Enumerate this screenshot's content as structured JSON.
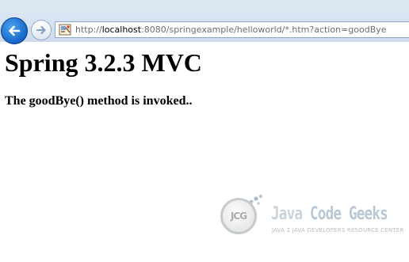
{
  "browser": {
    "back_icon": "arrow-left-icon",
    "forward_icon": "arrow-right-icon",
    "site_icon": "page-icon",
    "url": {
      "prefix": "http://",
      "host": "localhost",
      "rest": ":8080/springexample/helloworld/*.htm?action=goodBye"
    }
  },
  "page": {
    "heading": "Spring 3.2.3 MVC",
    "message": "The goodBye() method is invoked.."
  },
  "watermark": {
    "logo_text": "JCG",
    "brand_first": "Java ",
    "brand_second": "Code Geeks",
    "tagline": "JAVA 2 JAVA DEVELOPERS RESOURCE CENTER"
  },
  "colors": {
    "toolbar": "#d6e3f2",
    "back_button": "#1565c8",
    "watermark": "#c0c9d1"
  }
}
